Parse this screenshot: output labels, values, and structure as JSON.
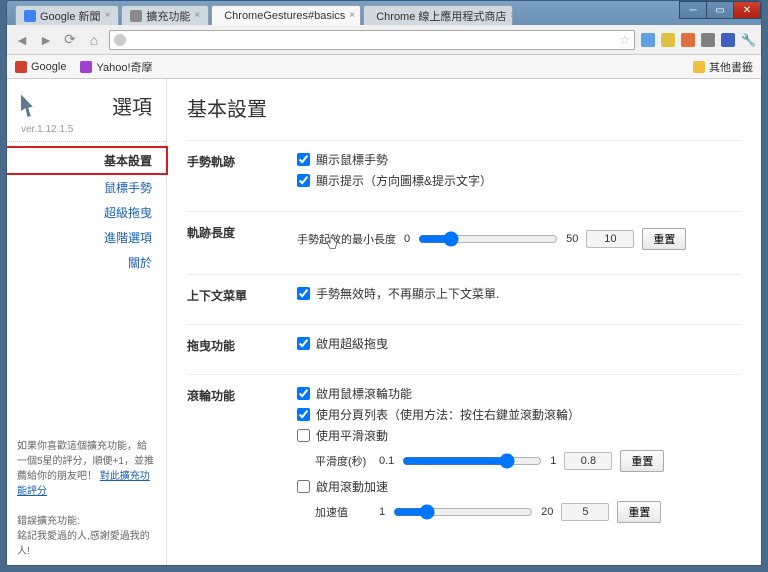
{
  "window": {
    "tabs": [
      {
        "title": "Google 新聞"
      },
      {
        "title": "擴充功能"
      },
      {
        "title": "ChromeGestures#basics"
      },
      {
        "title": "Chrome 線上應用程式商店"
      }
    ],
    "active_tab_index": 2
  },
  "toolbar": {
    "omnibox_value": ""
  },
  "bookmarks_bar": {
    "items": [
      "Google",
      "Yahoo!奇摩"
    ],
    "other": "其他書籤"
  },
  "sidebar": {
    "title": "選項",
    "version": "ver.1.12.1.5",
    "nav": [
      "基本設置",
      "鼠標手勢",
      "超級拖曳",
      "進階選項",
      "關於"
    ],
    "active_index": 0,
    "footer_line1": "如果你喜歡這個擴充功能，給一個5星的評分，順便+1，並推薦給你的朋友吧！",
    "footer_link": "對此擴充功能評分",
    "footer_line2": "錯誤擴充功能:",
    "footer_line3": "銘記我愛過的人,感謝愛過我的人!"
  },
  "page": {
    "title": "基本設置",
    "sections": {
      "gesture_trail": {
        "label": "手勢軌跡",
        "show_trail": "顯示鼠標手勢",
        "show_trail_checked": true,
        "show_hint": "顯示提示（方向圖標&提示文字）",
        "show_hint_checked": true
      },
      "trail_length": {
        "label": "軌跡長度",
        "slider_label": "手勢起效的最小長度",
        "min": "0",
        "max": "50",
        "value": "10",
        "reset": "重置"
      },
      "context_menu": {
        "label": "上下文菜單",
        "text": "手勢無效時，不再顯示上下文菜單.",
        "checked": true
      },
      "drag": {
        "label": "拖曳功能",
        "text": "啟用超級拖曳",
        "checked": true
      },
      "scroll": {
        "label": "滾輪功能",
        "enable_scroll": "啟用鼠標滾輪功能",
        "enable_scroll_checked": true,
        "page_list": "使用分頁列表（使用方法：按住右鍵並滾動滾輪）",
        "page_list_checked": true,
        "smooth": "使用平滑滾動",
        "smooth_checked": false,
        "smooth_label": "平滑度(秒)",
        "smooth_min": "0.1",
        "smooth_max": "1",
        "smooth_value": "0.8",
        "smooth_reset": "重置",
        "accel": "啟用滾動加速",
        "accel_checked": false,
        "accel_label": "加速值",
        "accel_min": "1",
        "accel_max": "20",
        "accel_value": "5",
        "accel_reset": "重置"
      }
    }
  }
}
